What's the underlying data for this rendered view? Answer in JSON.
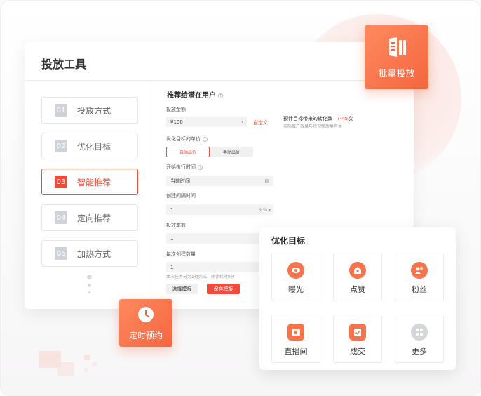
{
  "panel": {
    "title": "投放工具",
    "steps": [
      {
        "num": "01",
        "label": "投放方式"
      },
      {
        "num": "02",
        "label": "优化目标"
      },
      {
        "num": "03",
        "label": "智能推荐"
      },
      {
        "num": "04",
        "label": "定向推荐"
      },
      {
        "num": "05",
        "label": "加热方式"
      }
    ],
    "active_step": 3
  },
  "form": {
    "section_title": "推荐给潜在用户",
    "amount_label": "投放金额",
    "amount_value": "¥100",
    "custom_link": "自定义",
    "estimate_label": "预计目标带来的转化数",
    "estimate_range": "7-45",
    "estimate_unit": "次",
    "estimate_note": "实际推广效果与短视频质量有关",
    "unit_price_label": "优化目标的单价",
    "bid_auto": "自动出价",
    "bid_manual": "手动出价",
    "start_label": "开始执行时间",
    "start_value": "当前时间",
    "interval_label": "创建间隔时间",
    "interval_value": "1",
    "interval_unit": "分钟",
    "count_label": "投放笔数",
    "count_value": "1",
    "batch_label": "每次创建数量",
    "batch_value": "1",
    "batch_note": "本次任务分为1批完成，预计耗时0分",
    "select_template": "选择模板",
    "save_template": "保存模板"
  },
  "badges": {
    "batch": "批量投放",
    "schedule": "定时预约"
  },
  "goal_card": {
    "title": "优化目标",
    "items": [
      {
        "label": "曝光",
        "icon": "eye-icon"
      },
      {
        "label": "点赞",
        "icon": "thumb-up-icon"
      },
      {
        "label": "粉丝",
        "icon": "fans-icon"
      },
      {
        "label": "直播间",
        "icon": "live-room-icon"
      },
      {
        "label": "成交",
        "icon": "deal-icon"
      },
      {
        "label": "更多",
        "icon": "more-grid-icon"
      }
    ]
  },
  "colors": {
    "accent": "#f04b3a",
    "orange": "#f4663f",
    "orange_light": "#fe8a60"
  }
}
